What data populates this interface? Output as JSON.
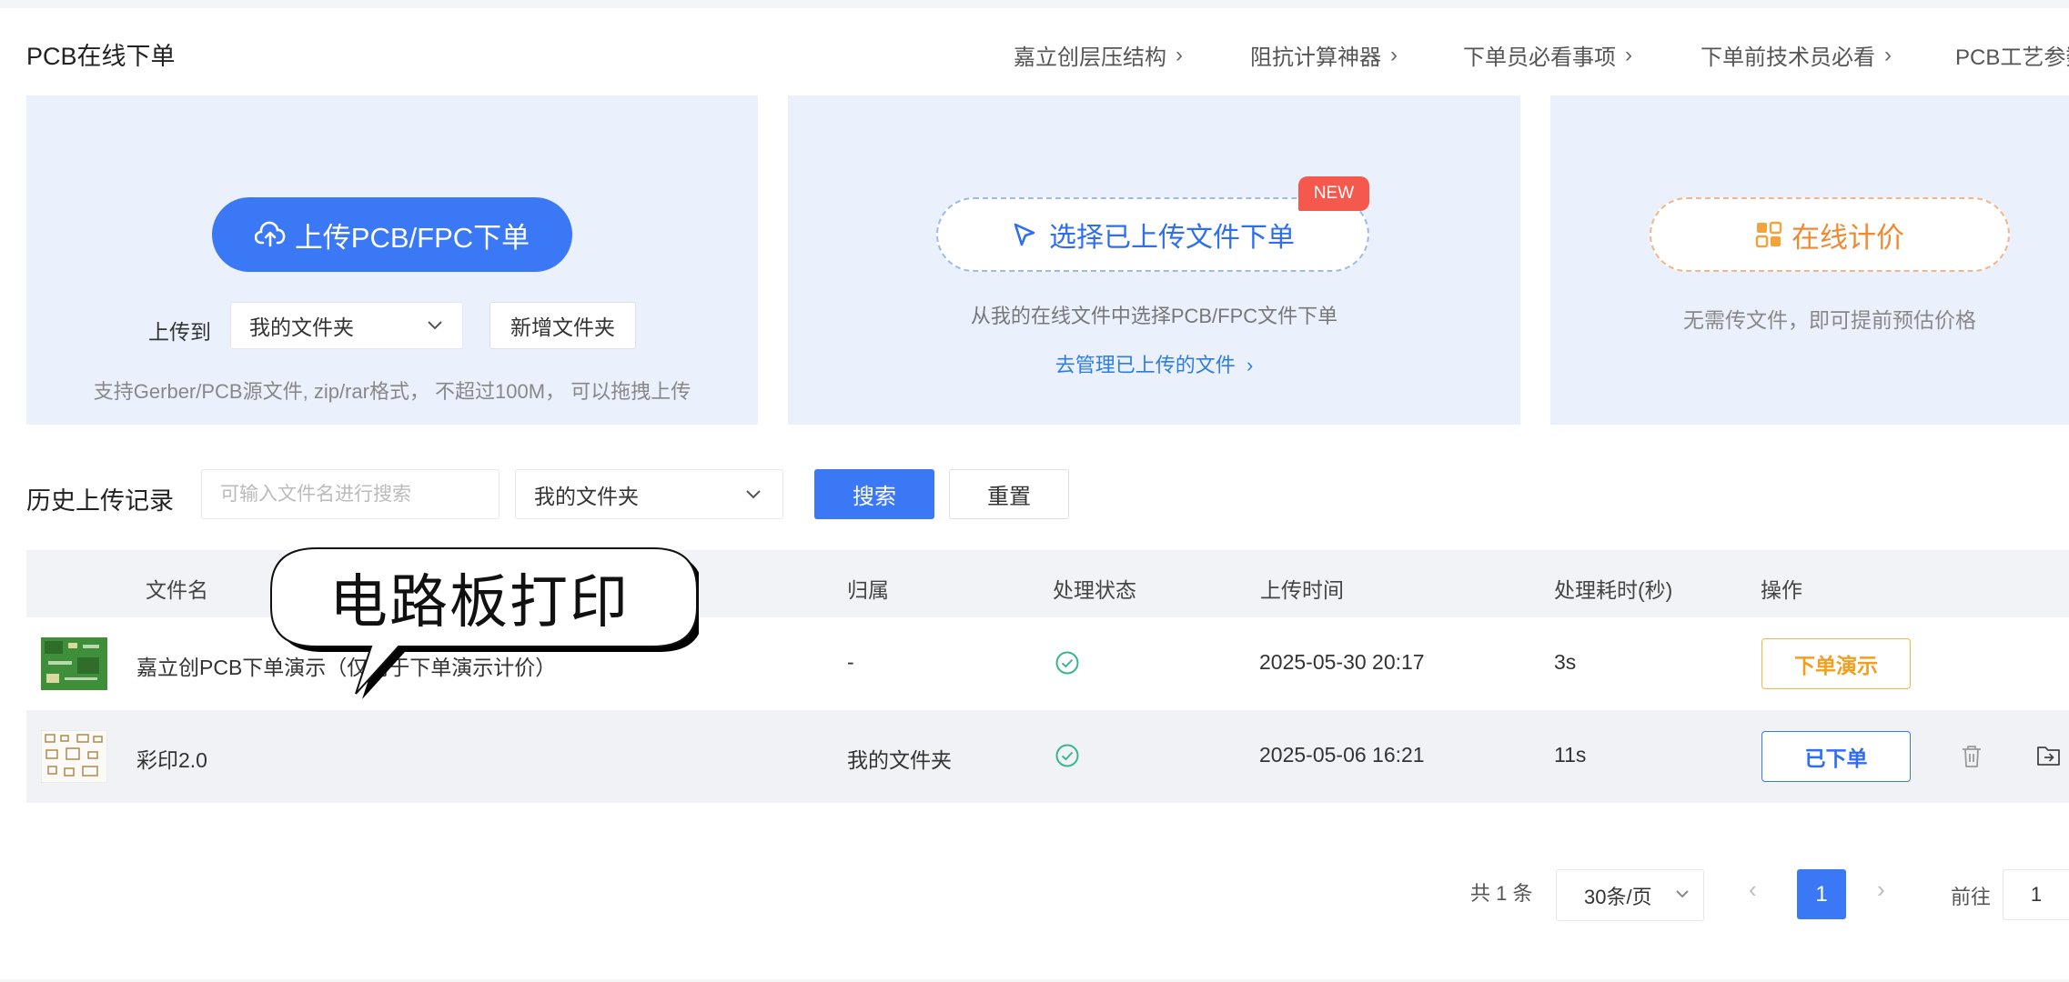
{
  "header": {
    "title": "PCB在线下单",
    "nav": [
      {
        "label": "嘉立创层压结构"
      },
      {
        "label": "阻抗计算神器"
      },
      {
        "label": "下单员必看事项"
      },
      {
        "label": "下单前技术员必看"
      },
      {
        "label": "PCB工艺参数"
      }
    ]
  },
  "upload_card": {
    "button_label": "上传PCB/FPC下单",
    "upload_to_label": "上传到",
    "folder_value": "我的文件夹",
    "new_folder_label": "新增文件夹",
    "hint": "支持Gerber/PCB源文件, zip/rar格式， 不超过100M， 可以拖拽上传"
  },
  "select_card": {
    "button_label": "选择已上传文件下单",
    "badge": "NEW",
    "hint": "从我的在线文件中选择PCB/FPC文件下单",
    "manage_link": "去管理已上传的文件"
  },
  "quote_card": {
    "button_label": "在线计价",
    "hint": "无需传文件，即可提前预估价格"
  },
  "history": {
    "title": "历史上传记录",
    "search_placeholder": "可输入文件名进行搜索",
    "folder_filter": "我的文件夹",
    "search_label": "搜索",
    "reset_label": "重置"
  },
  "table": {
    "columns": [
      "文件名",
      "归属",
      "处理状态",
      "上传时间",
      "处理耗时(秒)",
      "操作"
    ],
    "rows": [
      {
        "filename": "嘉立创PCB下单演示（仅用于下单演示计价）",
        "owner": "-",
        "upload_time": "2025-05-30 20:17",
        "duration": "3s",
        "action": "下单演示"
      },
      {
        "filename": "彩印2.0",
        "owner": "我的文件夹",
        "upload_time": "2025-05-06 16:21",
        "duration": "11s",
        "action": "已下单"
      }
    ]
  },
  "overlay": {
    "bubble_text": "电路板打印"
  },
  "pagination": {
    "total": "共 1 条",
    "page_size": "30条/页",
    "current_page": "1",
    "goto_label": "前往",
    "goto_value": "1"
  },
  "colors": {
    "primary": "#3b78f6",
    "card_bg": "#eaf1fd",
    "quote_orange": "#ef8a34",
    "badge_red": "#f5584c",
    "status_green": "#3bb58f"
  }
}
